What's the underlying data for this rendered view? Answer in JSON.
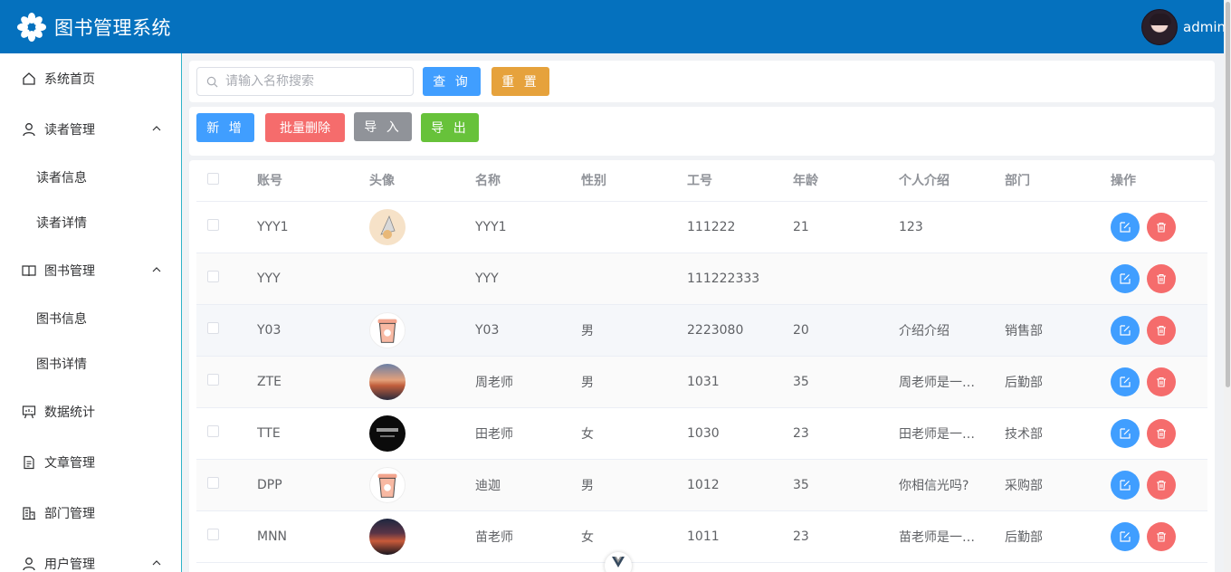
{
  "app": {
    "title": "图书管理系统",
    "username": "admin"
  },
  "sidebar": {
    "items": [
      {
        "label": "系统首页",
        "icon": "home-icon"
      },
      {
        "label": "读者管理",
        "icon": "user-icon",
        "expanded": true,
        "children": [
          "读者信息",
          "读者详情"
        ]
      },
      {
        "label": "图书管理",
        "icon": "book-icon",
        "expanded": true,
        "children": [
          "图书信息",
          "图书详情"
        ]
      },
      {
        "label": "数据统计",
        "icon": "chart-board-icon"
      },
      {
        "label": "文章管理",
        "icon": "document-icon"
      },
      {
        "label": "部门管理",
        "icon": "office-building-icon"
      },
      {
        "label": "用户管理",
        "icon": "user-icon",
        "expanded": true
      }
    ]
  },
  "search": {
    "placeholder": "请输入名称搜索",
    "value": "",
    "query_label": "查 询",
    "reset_label": "重 置"
  },
  "toolbar": {
    "add_label": "新 增",
    "batch_delete_label": "批量删除",
    "import_label": "导 入",
    "export_label": "导 出"
  },
  "table": {
    "columns": [
      "账号",
      "头像",
      "名称",
      "性别",
      "工号",
      "年龄",
      "个人介绍",
      "部门",
      "操作"
    ],
    "rows": [
      {
        "account": "YYY1",
        "avatar": "cat-sketch-avatar",
        "name": "YYY1",
        "gender": "",
        "number": "111222",
        "age": "21",
        "intro": "123",
        "dept": ""
      },
      {
        "account": "YYY",
        "avatar": "",
        "name": "YYY",
        "gender": "",
        "number": "111222333",
        "age": "",
        "intro": "",
        "dept": ""
      },
      {
        "account": "Y03",
        "avatar": "cup-avatar",
        "name": "Y03",
        "gender": "男",
        "number": "2223080",
        "age": "20",
        "intro": "介绍介绍",
        "dept": "销售部"
      },
      {
        "account": "ZTE",
        "avatar": "sunset-avatar",
        "name": "周老师",
        "gender": "男",
        "number": "1031",
        "age": "35",
        "intro": "周老师是一…",
        "dept": "后勤部"
      },
      {
        "account": "TTE",
        "avatar": "dark-text-avatar",
        "name": "田老师",
        "gender": "女",
        "number": "1030",
        "age": "23",
        "intro": "田老师是一…",
        "dept": "技术部"
      },
      {
        "account": "DPP",
        "avatar": "cup-avatar",
        "name": "迪迦",
        "gender": "男",
        "number": "1012",
        "age": "35",
        "intro": "你相信光吗?",
        "dept": "采购部"
      },
      {
        "account": "MNN",
        "avatar": "dusk-avatar",
        "name": "苗老师",
        "gender": "女",
        "number": "1011",
        "age": "23",
        "intro": "苗老师是一…",
        "dept": "后勤部"
      }
    ]
  },
  "colors": {
    "header": "#0571be",
    "primary": "#409eff",
    "warning": "#e6a23c",
    "danger": "#f56c6c",
    "info": "#909399",
    "success": "#67c23a"
  }
}
